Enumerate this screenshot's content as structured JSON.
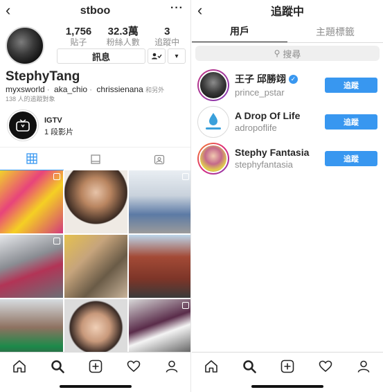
{
  "profile": {
    "title": "stboo",
    "back_icon": "chevron-left-icon",
    "more_label": "···",
    "stats": [
      {
        "num": "1,756",
        "label": "貼子"
      },
      {
        "num": "32.3萬",
        "label": "粉絲人數"
      },
      {
        "num": "3",
        "label": "追蹤中"
      }
    ],
    "message_label": "訊息",
    "display_name": "StephyTang",
    "tags": [
      "myxsworld",
      "aka_chio",
      "chrissienana"
    ],
    "tags_more": "和另外",
    "follower_note": "138 人的追蹤對象",
    "igtv_title": "IGTV",
    "igtv_sub": "1 段影片"
  },
  "following": {
    "title": "追蹤中",
    "tabs": [
      "用戶",
      "主題標籤"
    ],
    "search_placeholder": "搜尋",
    "users": [
      {
        "name": "王子 邱勝翊",
        "handle": "prince_pstar",
        "verified": true,
        "button": "追蹤"
      },
      {
        "name": "A Drop Of Life",
        "handle": "adropoflife",
        "verified": false,
        "button": "追蹤"
      },
      {
        "name": "Stephy Fantasia",
        "handle": "stephyfantasia",
        "verified": false,
        "button": "追蹤"
      }
    ]
  },
  "nav_icons": [
    "home-icon",
    "search-icon",
    "add-post-icon",
    "heart-icon",
    "profile-icon"
  ],
  "colors": {
    "accent": "#3897f0"
  }
}
